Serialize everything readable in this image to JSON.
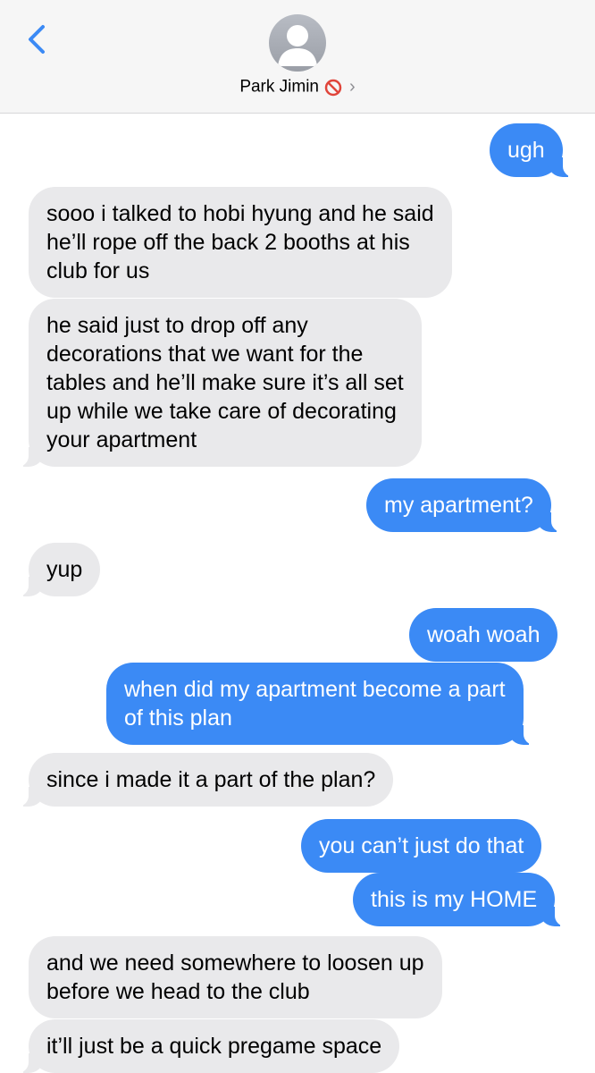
{
  "header": {
    "contact_name": "Park Jimin",
    "back_icon": "chevron-left-icon",
    "mute_icon": "prohibited-icon",
    "disclosure_icon": "chevron-right-icon",
    "avatar_icon": "person-silhouette-icon"
  },
  "colors": {
    "accent": "#3b8af5",
    "incoming_bubble": "#e9e9eb",
    "header_bg": "#f6f6f6",
    "mute_red": "#e0453b"
  },
  "messages": [
    {
      "direction": "outgoing",
      "lines": [
        "ugh"
      ]
    },
    {
      "direction": "incoming",
      "lines": [
        "sooo i talked to hobi hyung and he said",
        "he’ll rope off the back 2 booths at his",
        "club for us"
      ]
    },
    {
      "direction": "incoming",
      "lines": [
        "he said just to drop off any",
        "decorations that we want for the",
        "tables and he’ll make sure it’s all set",
        "up while we take care of decorating",
        "your apartment"
      ]
    },
    {
      "direction": "outgoing",
      "lines": [
        "my apartment?"
      ]
    },
    {
      "direction": "incoming",
      "lines": [
        "yup"
      ]
    },
    {
      "direction": "outgoing",
      "lines": [
        "woah woah"
      ]
    },
    {
      "direction": "outgoing",
      "lines": [
        "when did my apartment become a part",
        "of this plan"
      ]
    },
    {
      "direction": "incoming",
      "lines": [
        "since i made it a part of the plan?"
      ]
    },
    {
      "direction": "outgoing",
      "lines": [
        "you can’t just do that"
      ]
    },
    {
      "direction": "outgoing",
      "lines": [
        "this is my HOME"
      ]
    },
    {
      "direction": "incoming",
      "lines": [
        "and we need somewhere to loosen up",
        "before we head to the club"
      ]
    },
    {
      "direction": "incoming",
      "lines": [
        "it’ll just be a quick pregame space"
      ]
    }
  ]
}
